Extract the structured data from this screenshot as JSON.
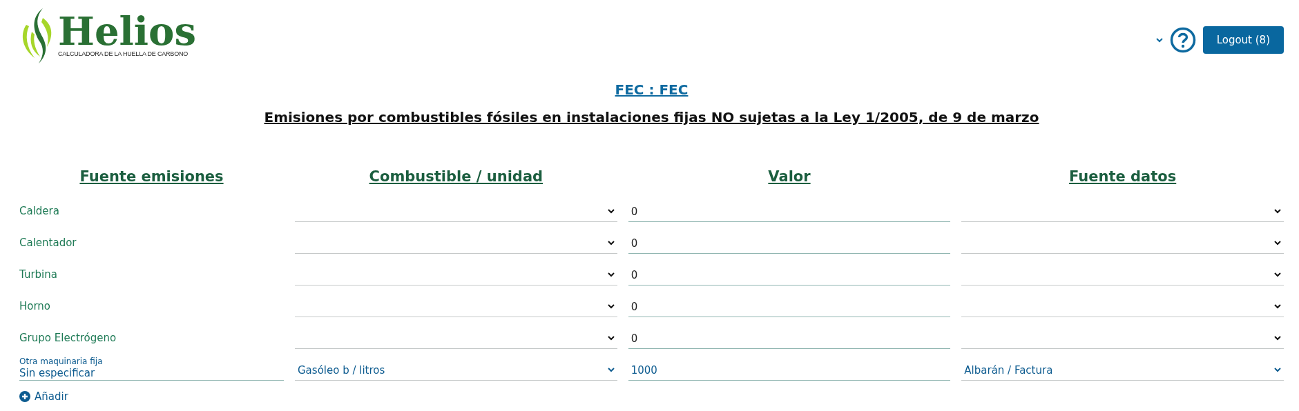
{
  "logo": {
    "name": "Helios",
    "tagline": "CALCULADORA DE LA HUELLA DE CARBONO"
  },
  "header": {
    "logout": "Logout (8)"
  },
  "title": {
    "link": "FEC : FEC",
    "subtitle": "Emisiones por combustibles fósiles en instalaciones fijas NO sujetas a la Ley 1/2005, de 9 de marzo"
  },
  "table": {
    "columns": [
      "Fuente emisiones",
      "Combustible / unidad",
      "Valor",
      "Fuente datos"
    ],
    "rows": [
      {
        "kind": "fixed",
        "source": "Caldera",
        "fuel": "",
        "value": "0",
        "data_source": ""
      },
      {
        "kind": "fixed",
        "source": "Calentador",
        "fuel": "",
        "value": "0",
        "data_source": ""
      },
      {
        "kind": "fixed",
        "source": "Turbina",
        "fuel": "",
        "value": "0",
        "data_source": ""
      },
      {
        "kind": "fixed",
        "source": "Horno",
        "fuel": "",
        "value": "0",
        "data_source": ""
      },
      {
        "kind": "fixed",
        "source": "Grupo Electrógeno",
        "fuel": "",
        "value": "0",
        "data_source": ""
      },
      {
        "kind": "custom",
        "source_label": "Otra maquinaria fija",
        "source": "Sin especificar",
        "fuel": "Gasóleo b / litros",
        "value": "1000",
        "data_source": "Albarán / Factura"
      }
    ]
  },
  "add_button": "Añadir"
}
